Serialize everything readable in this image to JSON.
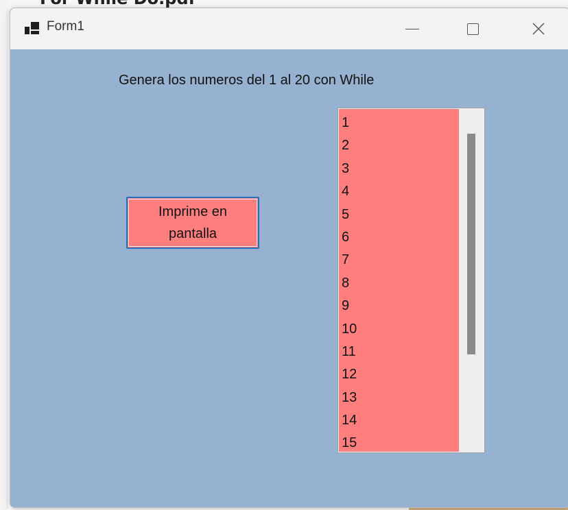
{
  "background": {
    "document_title_partial": "For While Do.pdf"
  },
  "window": {
    "title": "Form1",
    "controls": {
      "minimize_icon": "minimize-icon",
      "maximize_icon": "maximize-icon",
      "close_icon": "close-icon"
    }
  },
  "form": {
    "label": "Genera los numeros del 1 al 20 con While",
    "button_label": "Imprime en pantalla",
    "listbox": {
      "items": [
        "1",
        "2",
        "3",
        "4",
        "5",
        "6",
        "7",
        "8",
        "9",
        "10",
        "11",
        "12",
        "13",
        "14",
        "15"
      ]
    }
  },
  "colors": {
    "client_background": "#97b2d1",
    "control_fill": "#ff7f7f",
    "button_border": "#2b6fb8",
    "scroll_thumb": "#898989"
  }
}
